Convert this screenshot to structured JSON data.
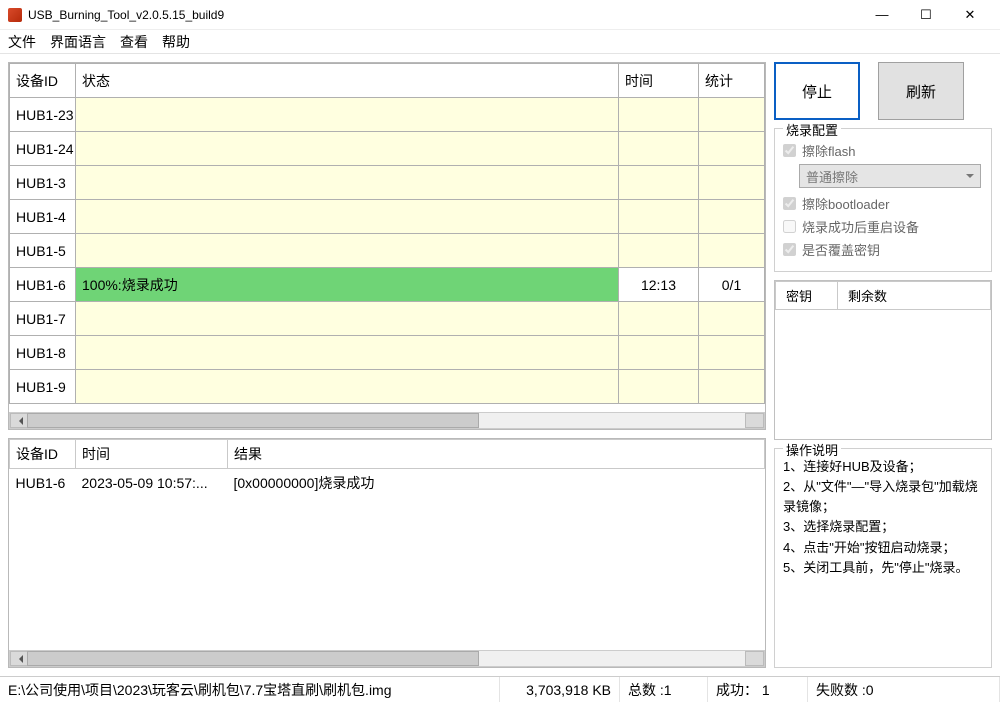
{
  "window": {
    "title": "USB_Burning_Tool_v2.0.5.15_build9"
  },
  "menu": {
    "file": "文件",
    "lang": "界面语言",
    "view": "查看",
    "help": "帮助"
  },
  "devHeaders": {
    "id": "设备ID",
    "status": "状态",
    "time": "时间",
    "stat": "统计"
  },
  "devices": [
    {
      "id": "HUB1-23",
      "status": "",
      "time": "",
      "stat": "",
      "cls": ""
    },
    {
      "id": "HUB1-24",
      "status": "",
      "time": "",
      "stat": "",
      "cls": ""
    },
    {
      "id": "HUB1-3",
      "status": "",
      "time": "",
      "stat": "",
      "cls": ""
    },
    {
      "id": "HUB1-4",
      "status": "",
      "time": "",
      "stat": "",
      "cls": ""
    },
    {
      "id": "HUB1-5",
      "status": "",
      "time": "",
      "stat": "",
      "cls": ""
    },
    {
      "id": "HUB1-6",
      "status": "100%:烧录成功",
      "time": "12:13",
      "stat": "0/1",
      "cls": "success"
    },
    {
      "id": "HUB1-7",
      "status": "",
      "time": "",
      "stat": "",
      "cls": ""
    },
    {
      "id": "HUB1-8",
      "status": "",
      "time": "",
      "stat": "",
      "cls": ""
    },
    {
      "id": "HUB1-9",
      "status": "",
      "time": "",
      "stat": "",
      "cls": ""
    }
  ],
  "logHeaders": {
    "id": "设备ID",
    "time": "时间",
    "result": "结果"
  },
  "logs": [
    {
      "id": "HUB1-6",
      "time": "2023-05-09 10:57:...",
      "result": "[0x00000000]烧录成功"
    }
  ],
  "buttons": {
    "stop": "停止",
    "refresh": "刷新"
  },
  "config": {
    "title": "烧录配置",
    "eraseFlash": "擦除flash",
    "eraseMode": "普通擦除",
    "eraseBoot": "擦除bootloader",
    "rebootAfter": "烧录成功后重启设备",
    "overwriteKey": "是否覆盖密钥"
  },
  "keyTable": {
    "key": "密钥",
    "remain": "剩余数"
  },
  "instr": {
    "title": "操作说明",
    "l1": "1、连接好HUB及设备；",
    "l2": "2、从\"文件\"—\"导入烧录包\"加载烧录镜像；",
    "l3": "3、选择烧录配置；",
    "l4": "4、点击\"开始\"按钮启动烧录；",
    "l5": "5、关闭工具前，先\"停止\"烧录。"
  },
  "status": {
    "path": "E:\\公司使用\\项目\\2023\\玩客云\\刷机包\\7.7宝塔直刷\\刷机包.img",
    "size": "3,703,918 KB",
    "totalLabel": "总数 :",
    "totalVal": "1",
    "succLabel": "成功：",
    "succVal": "1",
    "failLabel": "失败数 :",
    "failVal": "0"
  }
}
